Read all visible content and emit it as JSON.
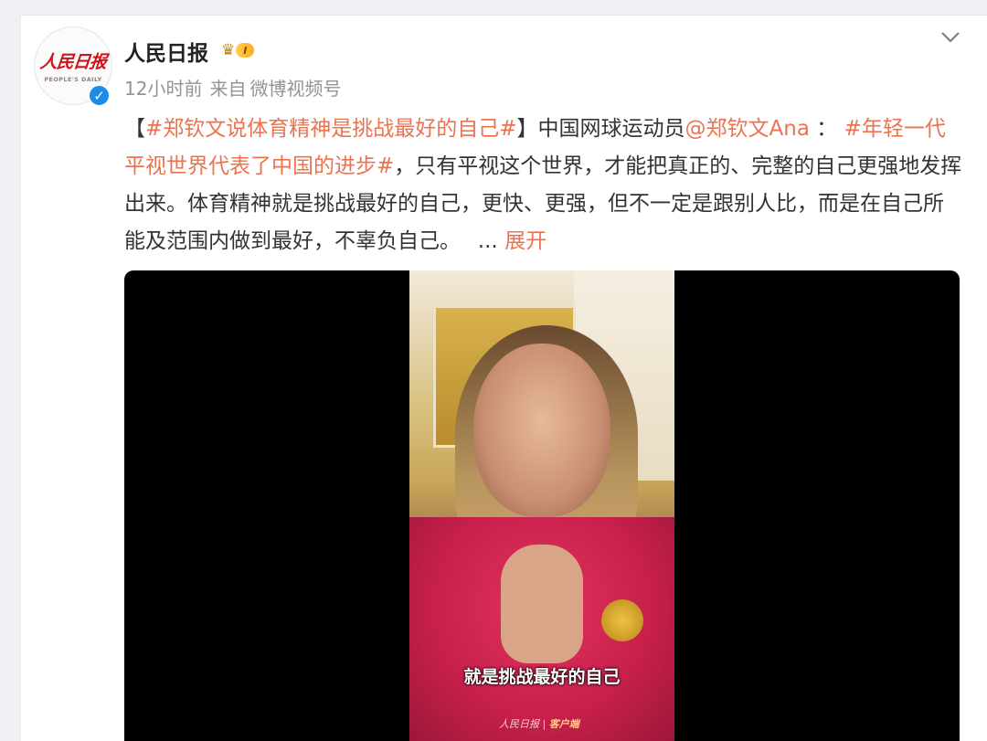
{
  "post": {
    "author": {
      "name": "人民日报",
      "avatar_cn": "人民日报",
      "avatar_en": "PEOPLE'S DAILY",
      "verified": true,
      "verified_icon": "check-icon",
      "level": "I",
      "crown_icon": "crown-icon"
    },
    "meta": {
      "time": "12小时前",
      "source_prefix": "来自",
      "source": "微博视频号"
    },
    "more_icon": "chevron-down-icon",
    "content": {
      "bracket_open": "【",
      "topic1": "#郑钦文说体育精神是挑战最好的自己#",
      "bracket_close": "】",
      "text1": "中国网球运动员",
      "mention": "@郑钦文Ana",
      "text2": " ：",
      "topic2": " #年轻一代平视世界代表了中国的进步#",
      "text3": "，只有平视这个世界，才能把真正的、完整的自己更强地发挥出来。体育精神就是挑战最好的自己，更快、更强，但不一定是跟别人比，而是在自己所能及范围内做到最好，不辜负自己。　 ... ",
      "expand": "展开"
    },
    "video": {
      "caption": "就是挑战最好的自己",
      "watermark_brand": "人民日报",
      "watermark_client": "客户端"
    }
  },
  "colors": {
    "link": "#eb7350",
    "verified": "#1e8ce6",
    "text": "#333333",
    "meta": "#939393"
  }
}
